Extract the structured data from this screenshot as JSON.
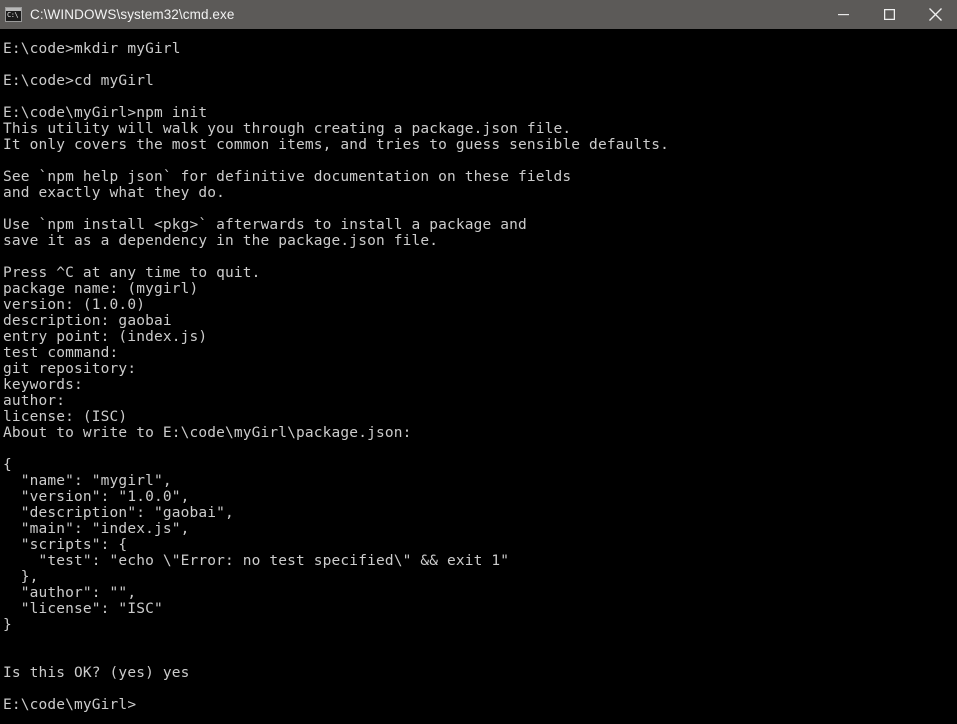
{
  "window": {
    "title": "C:\\WINDOWS\\system32\\cmd.exe",
    "icon": "cmd-console-icon",
    "icon_prompt_text": "C:\\",
    "titlebar_color": "#5c5a58",
    "titlebar_text_color": "#f2f2f2",
    "controls": [
      {
        "name": "minimize-button",
        "label": "Minimize",
        "glyph": "minimize-icon"
      },
      {
        "name": "maximize-button",
        "label": "Maximize",
        "glyph": "maximize-icon"
      },
      {
        "name": "close-button",
        "label": "Close",
        "glyph": "close-icon"
      }
    ]
  },
  "terminal": {
    "background_color": "#000000",
    "foreground_color": "#cccccc",
    "font_size_px": 14.5,
    "line_height_px": 16,
    "prompt_initial": "E:\\code>",
    "prompt_final": "E:\\code\\myGirl>",
    "commands": [
      "mkdir myGirl",
      "cd myGirl",
      "npm init"
    ],
    "lines": [
      "E:\\code>mkdir myGirl",
      "",
      "E:\\code>cd myGirl",
      "",
      "E:\\code\\myGirl>npm init",
      "This utility will walk you through creating a package.json file.",
      "It only covers the most common items, and tries to guess sensible defaults.",
      "",
      "See `npm help json` for definitive documentation on these fields",
      "and exactly what they do.",
      "",
      "Use `npm install <pkg>` afterwards to install a package and",
      "save it as a dependency in the package.json file.",
      "",
      "Press ^C at any time to quit.",
      "package name: (mygirl)",
      "version: (1.0.0)",
      "description: gaobai",
      "entry point: (index.js)",
      "test command:",
      "git repository:",
      "keywords:",
      "author:",
      "license: (ISC)",
      "About to write to E:\\code\\myGirl\\package.json:",
      "",
      "{",
      "  \"name\": \"mygirl\",",
      "  \"version\": \"1.0.0\",",
      "  \"description\": \"gaobai\",",
      "  \"main\": \"index.js\",",
      "  \"scripts\": {",
      "    \"test\": \"echo \\\"Error: no test specified\\\" && exit 1\"",
      "  },",
      "  \"author\": \"\",",
      "  \"license\": \"ISC\"",
      "}",
      "",
      "",
      "Is this OK? (yes) yes",
      "",
      "E:\\code\\myGirl>"
    ],
    "prompt_answers": {
      "package_name_default": "mygirl",
      "version_default": "1.0.0",
      "description_entered": "gaobai",
      "entry_point_default": "index.js",
      "test_command_entered": "",
      "git_repository_entered": "",
      "keywords_entered": "",
      "author_entered": "",
      "license_default": "ISC",
      "is_this_ok_default": "yes",
      "is_this_ok_entered": "yes"
    },
    "package_json": {
      "name": "mygirl",
      "version": "1.0.0",
      "description": "gaobai",
      "main": "index.js",
      "scripts": {
        "test": "echo \\\"Error: no test specified\\\" && exit 1"
      },
      "author": "",
      "license": "ISC"
    },
    "written_path": "E:\\code\\myGirl\\package.json"
  }
}
